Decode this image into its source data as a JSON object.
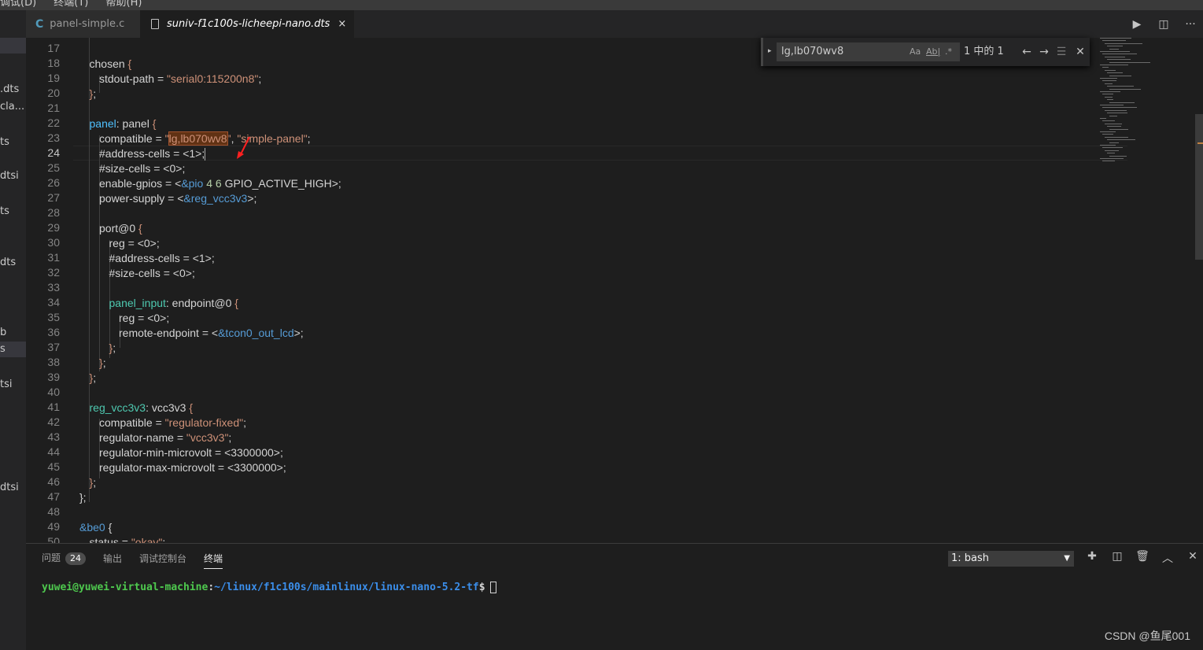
{
  "menubar": {
    "items": [
      "调试(D)",
      "终端(T)",
      "帮助(H)"
    ]
  },
  "tabs": [
    {
      "icon": "C",
      "label": "panel-simple.c",
      "active": false
    },
    {
      "label": "suniv-f1c100s-licheepi-nano.dts",
      "active": true,
      "close": "×"
    }
  ],
  "tab_actions": {
    "run": "▶",
    "split": "◫",
    "more": "···"
  },
  "sidebar_fragments": [
    ".dts",
    "cla...",
    "ts",
    "dtsi",
    "ts",
    "dts",
    "b",
    "s",
    "tsi",
    "dtsi"
  ],
  "find_widget": {
    "toggle": "▸",
    "query": "lg,lb070wv8",
    "match_case": "Aa",
    "whole_word": "Ab|",
    "regex": ".*",
    "result_count": "1 中的 1",
    "prev": "←",
    "next": "→",
    "in_selection": "☰",
    "close": "✕"
  },
  "editor": {
    "current_line": "24",
    "lines": [
      {
        "n": "17",
        "parts": []
      },
      {
        "n": "18",
        "parts": [
          [
            "t-node",
            "chosen "
          ],
          [
            "t-brace",
            "{"
          ]
        ]
      },
      {
        "n": "19",
        "parts": [
          [
            "t-prop",
            "stdout-path = "
          ],
          [
            "t-str",
            "\"serial0:115200n8\""
          ],
          [
            "t-plain",
            ";"
          ]
        ]
      },
      {
        "n": "20",
        "parts": [
          [
            "t-brace",
            "}"
          ],
          [
            "t-plain",
            ";"
          ]
        ]
      },
      {
        "n": "21",
        "parts": []
      },
      {
        "n": "22",
        "parts": [
          [
            "t-label",
            "panel"
          ],
          [
            "t-plain",
            ": panel "
          ],
          [
            "t-brace",
            "{"
          ]
        ]
      },
      {
        "n": "23",
        "parts": [
          [
            "t-prop",
            "compatible = "
          ],
          [
            "t-str",
            "\""
          ],
          [
            "t-str hl",
            "lg,lb070wv8"
          ],
          [
            "t-str",
            "\""
          ],
          [
            "t-plain",
            ", "
          ],
          [
            "t-str",
            "\"simple-panel\""
          ],
          [
            "t-plain",
            ";"
          ]
        ]
      },
      {
        "n": "24",
        "parts": [
          [
            "t-prop",
            "#address-cells = <1>;"
          ]
        ]
      },
      {
        "n": "25",
        "parts": [
          [
            "t-prop",
            "#size-cells = <0>;"
          ]
        ]
      },
      {
        "n": "26",
        "parts": [
          [
            "t-prop",
            "enable-gpios = <"
          ],
          [
            "t-ref",
            "&pio"
          ],
          [
            "t-num",
            " 4 6 "
          ],
          [
            "t-prop",
            "GPIO_ACTIVE_HIGH>;"
          ]
        ]
      },
      {
        "n": "27",
        "parts": [
          [
            "t-prop",
            "power-supply = <"
          ],
          [
            "t-ref",
            "&reg_vcc3v3"
          ],
          [
            "t-plain",
            ">;"
          ]
        ]
      },
      {
        "n": "28",
        "parts": []
      },
      {
        "n": "29",
        "parts": [
          [
            "t-node",
            "port@0 "
          ],
          [
            "t-brace",
            "{"
          ]
        ]
      },
      {
        "n": "30",
        "parts": [
          [
            "t-prop",
            "reg = <0>;"
          ]
        ]
      },
      {
        "n": "31",
        "parts": [
          [
            "t-prop",
            "#address-cells = <1>;"
          ]
        ]
      },
      {
        "n": "32",
        "parts": [
          [
            "t-prop",
            "#size-cells = <0>;"
          ]
        ]
      },
      {
        "n": "33",
        "parts": []
      },
      {
        "n": "34",
        "parts": [
          [
            "t-label2",
            "panel_input"
          ],
          [
            "t-plain",
            ": endpoint@0 "
          ],
          [
            "t-brace",
            "{"
          ]
        ]
      },
      {
        "n": "35",
        "parts": [
          [
            "t-prop",
            "reg = <0>;"
          ]
        ]
      },
      {
        "n": "36",
        "parts": [
          [
            "t-prop",
            "remote-endpoint = <"
          ],
          [
            "t-ref",
            "&tcon0_out_lcd"
          ],
          [
            "t-plain",
            ">;"
          ]
        ]
      },
      {
        "n": "37",
        "parts": [
          [
            "t-brace",
            "}"
          ],
          [
            "t-plain",
            ";"
          ]
        ]
      },
      {
        "n": "38",
        "parts": [
          [
            "t-brace",
            "}"
          ],
          [
            "t-plain",
            ";"
          ]
        ]
      },
      {
        "n": "39",
        "parts": [
          [
            "t-brace",
            "}"
          ],
          [
            "t-plain",
            ";"
          ]
        ]
      },
      {
        "n": "40",
        "parts": []
      },
      {
        "n": "41",
        "parts": [
          [
            "t-label2",
            "reg_vcc3v3"
          ],
          [
            "t-plain",
            ": vcc3v3 "
          ],
          [
            "t-brace",
            "{"
          ]
        ]
      },
      {
        "n": "42",
        "parts": [
          [
            "t-prop",
            "compatible = "
          ],
          [
            "t-str",
            "\"regulator-fixed\""
          ],
          [
            "t-plain",
            ";"
          ]
        ]
      },
      {
        "n": "43",
        "parts": [
          [
            "t-prop",
            "regulator-name = "
          ],
          [
            "t-str",
            "\"vcc3v3\""
          ],
          [
            "t-plain",
            ";"
          ]
        ]
      },
      {
        "n": "44",
        "parts": [
          [
            "t-prop",
            "regulator-min-microvolt = <3300000>;"
          ]
        ]
      },
      {
        "n": "45",
        "parts": [
          [
            "t-prop",
            "regulator-max-microvolt = <3300000>;"
          ]
        ]
      },
      {
        "n": "46",
        "parts": [
          [
            "t-brace",
            "}"
          ],
          [
            "t-plain",
            ";"
          ]
        ]
      },
      {
        "n": "47",
        "parts": [
          [
            "t-plain",
            "};"
          ]
        ]
      },
      {
        "n": "48",
        "parts": []
      },
      {
        "n": "49",
        "parts": [
          [
            "t-ref",
            "&be0"
          ],
          [
            "t-plain",
            " {"
          ]
        ]
      },
      {
        "n": "50",
        "parts": [
          [
            "t-prop",
            "status = "
          ],
          [
            "t-str",
            "\"okay\""
          ],
          [
            "t-plain",
            ";"
          ]
        ]
      }
    ]
  },
  "panel": {
    "tabs": [
      {
        "label": "问题",
        "badge": "24"
      },
      {
        "label": "输出"
      },
      {
        "label": "调试控制台"
      },
      {
        "label": "终端",
        "active": true
      }
    ],
    "terminal_select": "1: bash",
    "select_caret": "▼",
    "actions": {
      "add": "✚",
      "split": "◫",
      "trash": "🗑",
      "maximize": "︿",
      "close": "✕"
    },
    "prompt_user": "yuwei@yuwei-virtual-machine",
    "prompt_sep": ":",
    "prompt_path": "~/linux/f1c100s/mainlinux/linux-nano-5.2-tf",
    "prompt_dollar": "$"
  },
  "watermark": "CSDN @鱼尾001"
}
